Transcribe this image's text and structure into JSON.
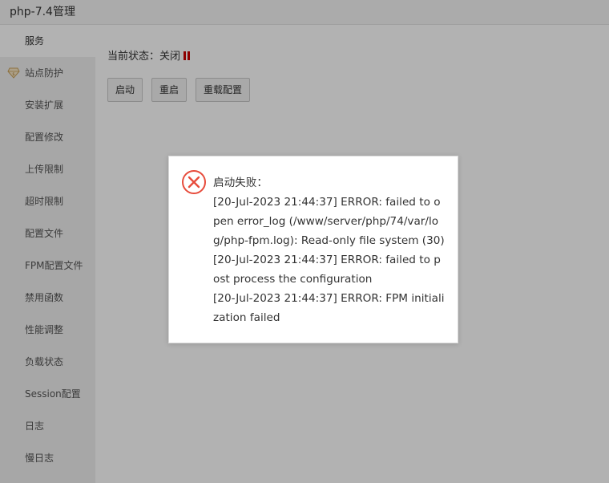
{
  "window": {
    "title": "php-7.4管理"
  },
  "sidebar": {
    "items": [
      {
        "label": "服务",
        "active": true
      },
      {
        "label": "站点防护",
        "icon": "diamond-badge-icon"
      },
      {
        "label": "安装扩展"
      },
      {
        "label": "配置修改"
      },
      {
        "label": "上传限制"
      },
      {
        "label": "超时限制"
      },
      {
        "label": "配置文件"
      },
      {
        "label": "FPM配置文件"
      },
      {
        "label": "禁用函数"
      },
      {
        "label": "性能调整"
      },
      {
        "label": "负载状态"
      },
      {
        "label": "Session配置"
      },
      {
        "label": "日志"
      },
      {
        "label": "慢日志"
      }
    ]
  },
  "main": {
    "status_label": "当前状态：关闭",
    "status_icon": "pause-icon",
    "status_color": "#cc0000",
    "buttons": {
      "start": "启动",
      "restart": "重启",
      "reload": "重载配置"
    }
  },
  "dialog": {
    "icon": "error-circle-icon",
    "icon_color": "#e74c3c",
    "title": "启动失败：",
    "lines": [
      "[20-Jul-2023 21:44:37] ERROR: failed to open error_log (/www/server/php/74/var/log/php-fpm.log): Read-only file system (30)",
      "[20-Jul-2023 21:44:37] ERROR: failed to post process the configuration",
      "[20-Jul-2023 21:44:37] ERROR: FPM initialization failed"
    ]
  }
}
